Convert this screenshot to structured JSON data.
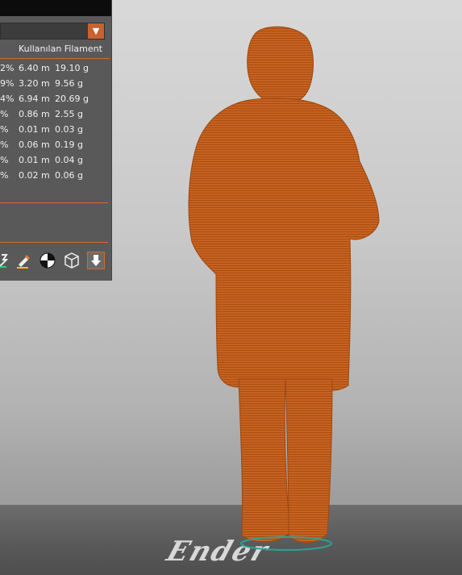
{
  "panel": {
    "column_header": "Kullanılan Filament",
    "rows": [
      {
        "pct": "2%",
        "length": "6.40 m",
        "weight": "19.10 g"
      },
      {
        "pct": "9%",
        "length": "3.20 m",
        "weight": "9.56 g"
      },
      {
        "pct": "4%",
        "length": "6.94 m",
        "weight": "20.69 g"
      },
      {
        "pct": "%",
        "length": "0.86 m",
        "weight": "2.55 g"
      },
      {
        "pct": "%",
        "length": "0.01 m",
        "weight": "0.03 g"
      },
      {
        "pct": "%",
        "length": "0.06 m",
        "weight": "0.19 g"
      },
      {
        "pct": "%",
        "length": "0.01 m",
        "weight": "0.04 g"
      },
      {
        "pct": "%",
        "length": "0.02 m",
        "weight": "0.06 g"
      }
    ],
    "tools": [
      "color-change-icon",
      "paint-brush-icon",
      "seam-painting-icon",
      "cube-outline-icon",
      "download-arrow-icon"
    ],
    "active_tool_index": 4
  },
  "colors": {
    "accent": "#d46a2c",
    "model": "#c8621f"
  },
  "bed": {
    "logo_text": "Ender"
  }
}
